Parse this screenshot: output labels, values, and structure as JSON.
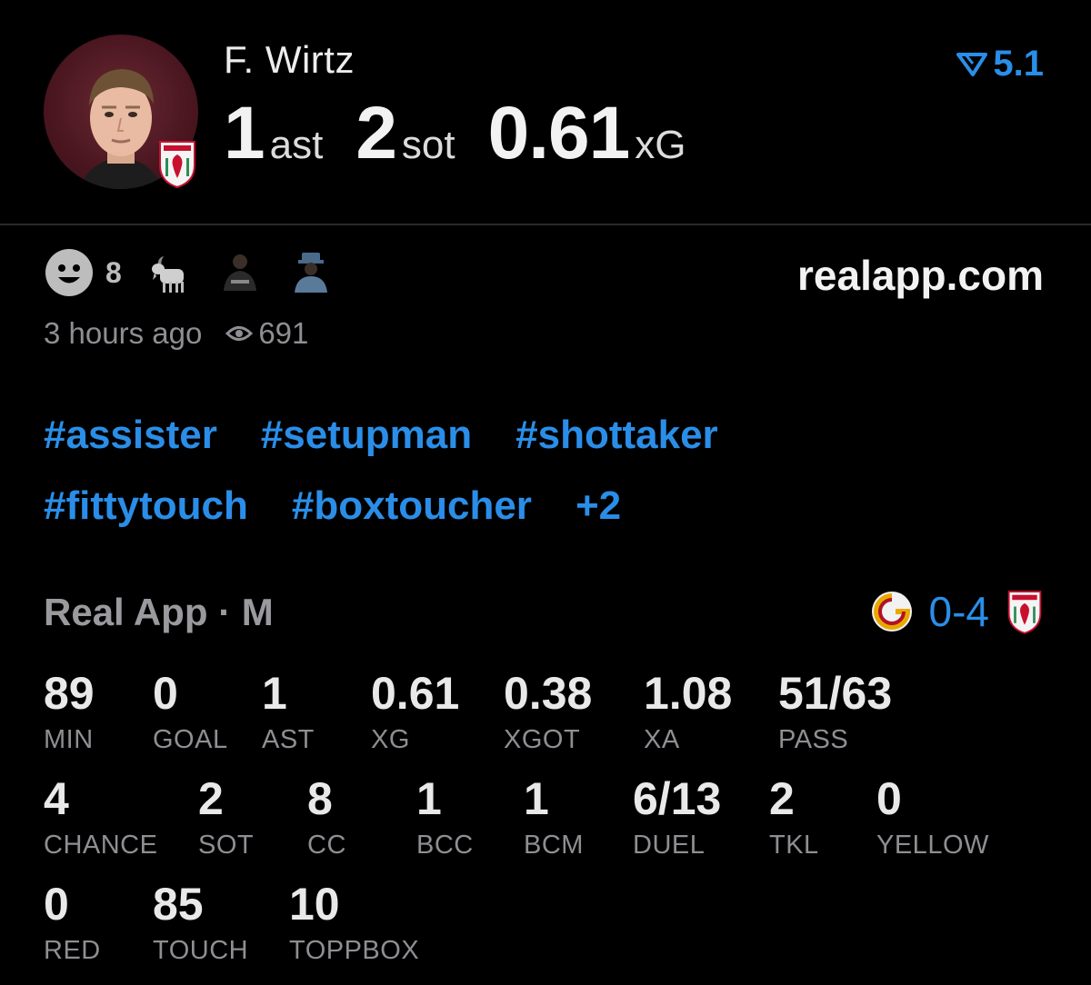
{
  "player": {
    "name": "F. Wirtz",
    "headline": [
      {
        "value": "1",
        "unit": "ast"
      },
      {
        "value": "2",
        "unit": "sot"
      },
      {
        "value": "0.61",
        "unit": "xG"
      }
    ],
    "rating": "5.1",
    "rating_icon": "vote-arrow-icon"
  },
  "colors": {
    "accent": "#2a8ee8",
    "background": "#000000",
    "muted": "#8e8e93"
  },
  "reactions": {
    "smiley_count": "8"
  },
  "source": "realapp.com",
  "meta": {
    "time": "3 hours ago",
    "views": "691"
  },
  "tags": {
    "row1": [
      "#assister",
      "#setupman",
      "#shottaker"
    ],
    "row2": [
      "#fittytouch",
      "#boxtoucher",
      "+2"
    ]
  },
  "match": {
    "label": "Real App · M",
    "score": "0-4"
  },
  "stats": {
    "row1": [
      {
        "value": "89",
        "label": "MIN"
      },
      {
        "value": "0",
        "label": "GOAL"
      },
      {
        "value": "1",
        "label": "AST"
      },
      {
        "value": "0.61",
        "label": "XG"
      },
      {
        "value": "0.38",
        "label": "XGOT"
      },
      {
        "value": "1.08",
        "label": "XA"
      },
      {
        "value": "51/63",
        "label": "PASS"
      }
    ],
    "row2": [
      {
        "value": "4",
        "label": "CHANCE"
      },
      {
        "value": "2",
        "label": "SOT"
      },
      {
        "value": "8",
        "label": "CC"
      },
      {
        "value": "1",
        "label": "BCC"
      },
      {
        "value": "1",
        "label": "BCM"
      },
      {
        "value": "6/13",
        "label": "DUEL"
      },
      {
        "value": "2",
        "label": "TKL"
      },
      {
        "value": "0",
        "label": "YELLOW"
      }
    ],
    "row3": [
      {
        "value": "0",
        "label": "RED"
      },
      {
        "value": "85",
        "label": "TOUCH"
      },
      {
        "value": "10",
        "label": "TOPPBOX"
      }
    ]
  }
}
